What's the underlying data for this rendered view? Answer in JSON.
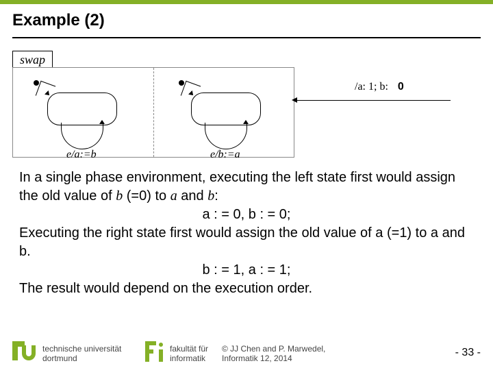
{
  "title": "Example (2)",
  "figure": {
    "swap_label": "swap",
    "left_transition": "e/a:=b",
    "right_transition": "e/b:=a",
    "init_label": "/a:  1;  b:",
    "init_value": "0"
  },
  "body": {
    "p1a": "In a single phase environment, executing the left state first would assign the old value of ",
    "p1_b": "b",
    "p1_mid": " (=0) to ",
    "p1_a": "a",
    "p1_and": " and ",
    "p1_b2": "b",
    "p1_colon": ":",
    "line1": "a : = 0, b : = 0;",
    "p2": "Executing the right state first would assign the old value of a (=1) to a and b.",
    "line2": "b : = 1, a : = 1;",
    "p3": "The result would depend on the execution order."
  },
  "footer": {
    "uni1": "technische universität",
    "uni2": "dortmund",
    "fak1": "fakultät für",
    "fak2": "informatik",
    "copy1": "© JJ Chen and  P. Marwedel,",
    "copy2": "Informatik 12,  2014",
    "page": "-  33 -"
  }
}
